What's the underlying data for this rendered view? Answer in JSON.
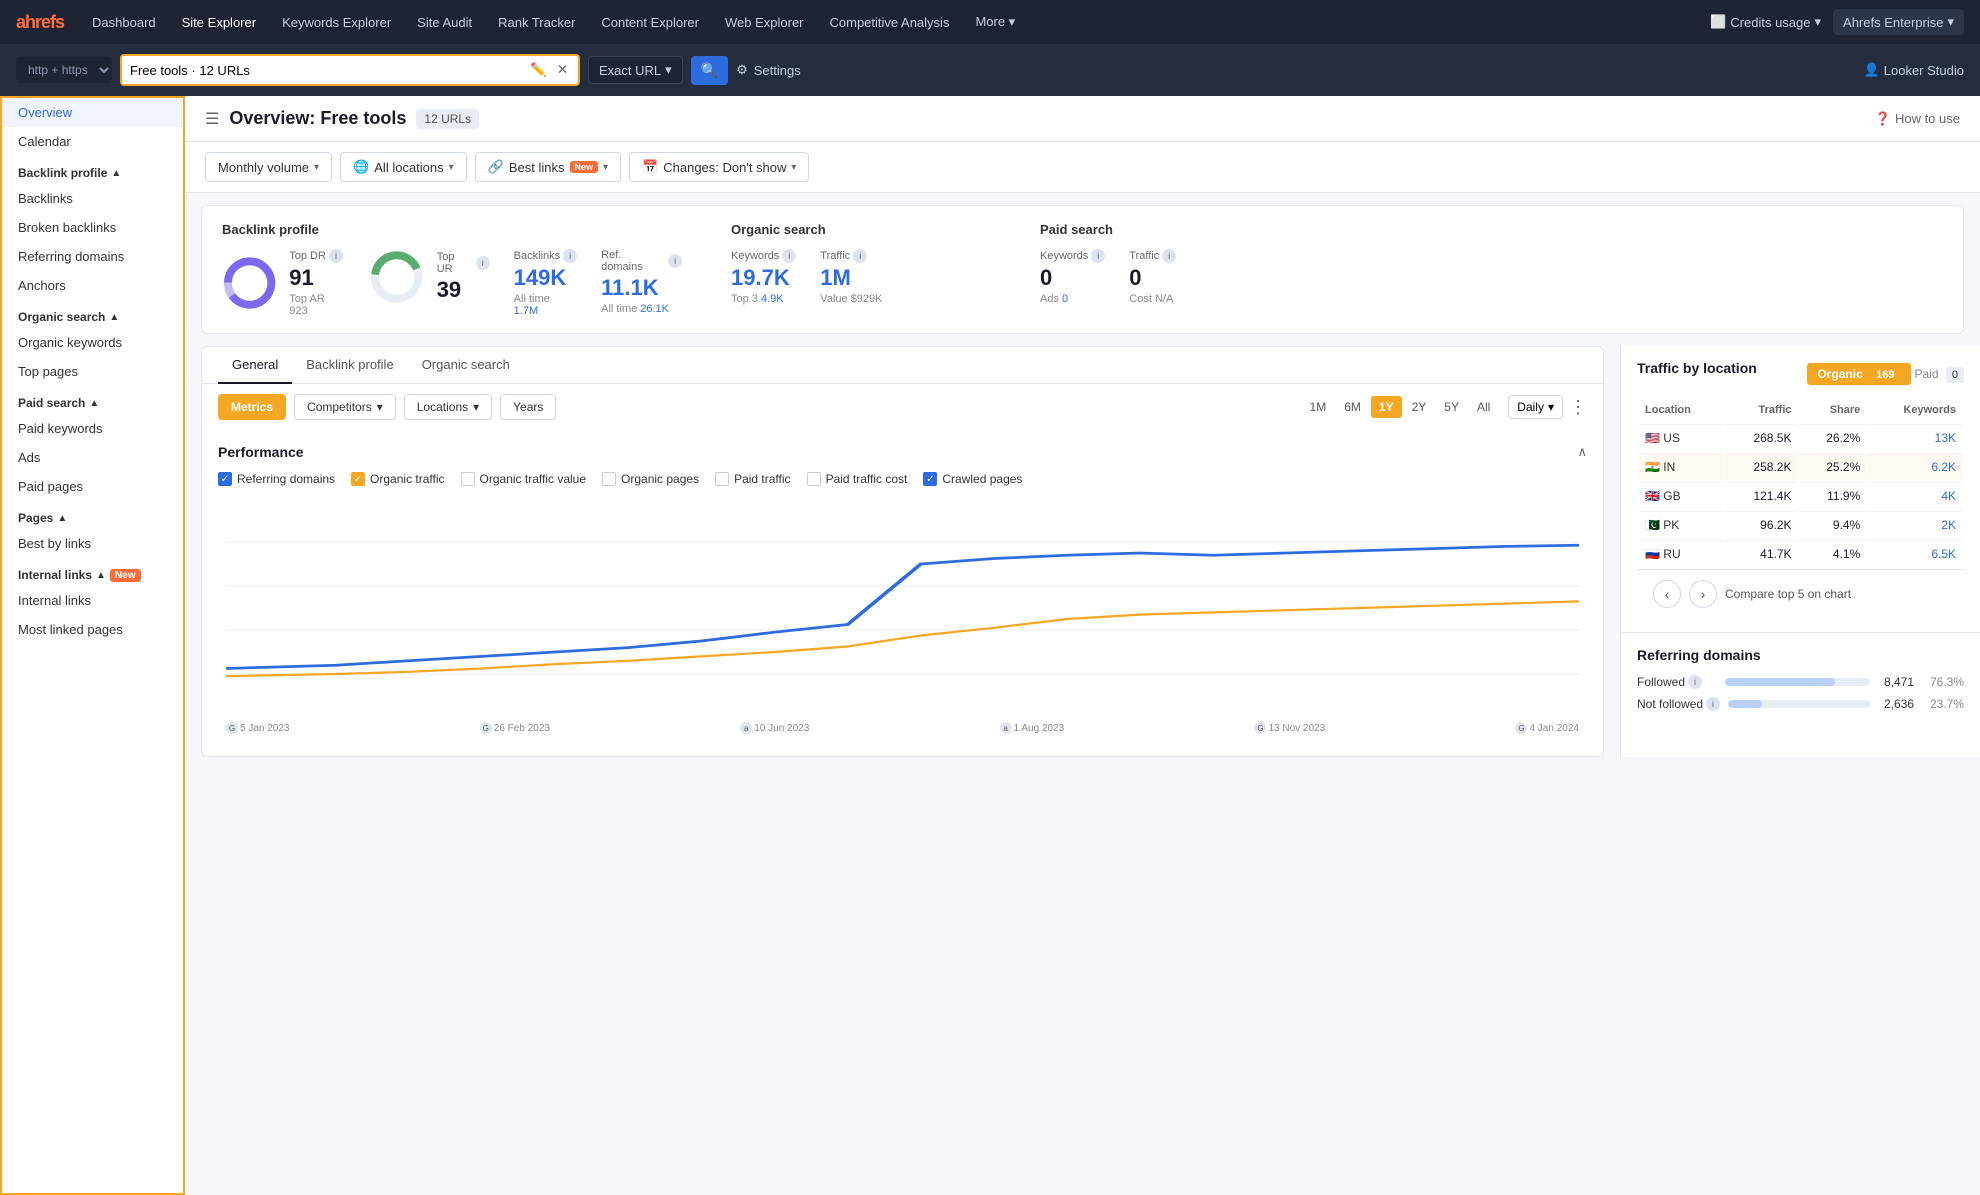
{
  "nav": {
    "logo": "ahrefs",
    "items": [
      "Dashboard",
      "Site Explorer",
      "Keywords Explorer",
      "Site Audit",
      "Rank Tracker",
      "Content Explorer",
      "Web Explorer",
      "Competitive Analysis",
      "More"
    ],
    "active": "Site Explorer",
    "credits_label": "Credits usage",
    "enterprise_label": "Ahrefs Enterprise"
  },
  "urlbar": {
    "protocol": "http + https",
    "url_value": "Free tools · 12 URLs",
    "match_type": "Exact URL",
    "settings_label": "Settings",
    "looker_label": "Looker Studio"
  },
  "page": {
    "title": "Overview: Free tools",
    "url_count": "12 URLs",
    "how_to_use": "How to use"
  },
  "filters": {
    "monthly_volume": "Monthly volume",
    "all_locations": "All locations",
    "best_links": "Best links",
    "best_links_badge": "New",
    "changes": "Changes: Don't show"
  },
  "stats": {
    "backlink_profile_title": "Backlink profile",
    "top_dr_label": "Top DR",
    "top_dr_value": "91",
    "top_ar_label": "Top AR",
    "top_ar_value": "923",
    "top_ur_label": "Top UR",
    "top_ur_value": "39",
    "backlinks_label": "Backlinks",
    "backlinks_value": "149K",
    "backlinks_sub": "All time",
    "backlinks_sub_val": "1.7M",
    "ref_domains_label": "Ref. domains",
    "ref_domains_value": "11.1K",
    "ref_domains_sub": "All time",
    "ref_domains_sub_val": "26.1K",
    "organic_search_title": "Organic search",
    "org_kw_label": "Keywords",
    "org_kw_value": "19.7K",
    "org_kw_sub": "Top 3",
    "org_kw_sub_val": "4.9K",
    "org_traffic_label": "Traffic",
    "org_traffic_value": "1M",
    "org_traffic_sub": "Value",
    "org_traffic_sub_val": "$929K",
    "paid_search_title": "Paid search",
    "paid_kw_label": "Keywords",
    "paid_kw_value": "0",
    "paid_kw_sub": "Ads",
    "paid_kw_sub_val": "0",
    "paid_traffic_label": "Traffic",
    "paid_traffic_value": "0",
    "paid_traffic_sub": "Cost",
    "paid_traffic_sub_val": "N/A"
  },
  "chart_tabs": [
    "General",
    "Backlink profile",
    "Organic search"
  ],
  "chart_controls": {
    "metrics": "Metrics",
    "competitors": "Competitors",
    "locations": "Locations",
    "years": "Years"
  },
  "time_buttons": [
    "1M",
    "6M",
    "1Y",
    "2Y",
    "5Y",
    "All"
  ],
  "active_time": "1Y",
  "interval": "Daily",
  "performance": {
    "title": "Performance",
    "checkboxes": [
      {
        "label": "Referring domains",
        "checked": true,
        "color": "blue"
      },
      {
        "label": "Organic traffic",
        "checked": true,
        "color": "orange"
      },
      {
        "label": "Organic traffic value",
        "checked": false,
        "color": "none"
      },
      {
        "label": "Organic pages",
        "checked": false,
        "color": "none"
      },
      {
        "label": "Paid traffic",
        "checked": false,
        "color": "none"
      },
      {
        "label": "Paid traffic cost",
        "checked": false,
        "color": "none"
      },
      {
        "label": "Crawled pages",
        "checked": true,
        "color": "blue2"
      }
    ]
  },
  "x_labels": [
    {
      "date": "5 Jan 2023",
      "icon": "G"
    },
    {
      "date": "26 Feb 2023",
      "icon": "G"
    },
    {
      "date": "10 Jun 2023",
      "icon": "a"
    },
    {
      "date": "1 Aug 2023",
      "icon": "a"
    },
    {
      "date": "13 Nov 2023",
      "icon": "G"
    },
    {
      "date": "4 Jan 2024",
      "icon": "G"
    }
  ],
  "right_panel": {
    "traffic_by_location_title": "Traffic by location",
    "organic_tab": "Organic",
    "organic_count": "169",
    "paid_tab": "Paid",
    "paid_count": "0",
    "table_headers": [
      "Location",
      "Traffic",
      "Share",
      "Keywords"
    ],
    "locations": [
      {
        "code": "US",
        "flag": "🇺🇸",
        "traffic": "268.5K",
        "share": "26.2%",
        "keywords": "13K",
        "highlighted": false
      },
      {
        "code": "IN",
        "flag": "🇮🇳",
        "traffic": "258.2K",
        "share": "25.2%",
        "keywords": "6.2K",
        "highlighted": true
      },
      {
        "code": "GB",
        "flag": "🇬🇧",
        "traffic": "121.4K",
        "share": "11.9%",
        "keywords": "4K",
        "highlighted": false
      },
      {
        "code": "PK",
        "flag": "🇵🇰",
        "traffic": "96.2K",
        "share": "9.4%",
        "keywords": "2K",
        "highlighted": false
      },
      {
        "code": "RU",
        "flag": "🇷🇺",
        "traffic": "41.7K",
        "share": "4.1%",
        "keywords": "6.5K",
        "highlighted": false
      }
    ],
    "compare_label": "Compare top 5 on chart",
    "referring_domains_title": "Referring domains",
    "ref_rows": [
      {
        "label": "Followed",
        "value": "8,471",
        "pct": "76.3%",
        "bar_pct": 76
      },
      {
        "label": "Not followed",
        "value": "2,636",
        "pct": "23.7%",
        "bar_pct": 24
      }
    ]
  },
  "sidebar": {
    "items": [
      {
        "label": "Overview",
        "active": true
      },
      {
        "label": "Calendar",
        "active": false
      }
    ],
    "sections": [
      {
        "title": "Backlink profile",
        "items": [
          "Backlinks",
          "Broken backlinks",
          "Referring domains",
          "Anchors"
        ]
      },
      {
        "title": "Organic search",
        "items": [
          "Organic keywords",
          "Top pages"
        ]
      },
      {
        "title": "Paid search",
        "items": [
          "Paid keywords",
          "Ads",
          "Paid pages"
        ]
      },
      {
        "title": "Pages",
        "items": [
          "Best by links"
        ]
      },
      {
        "title": "Internal links",
        "badge": "New",
        "items": [
          "Internal links",
          "Most linked pages"
        ]
      }
    ]
  }
}
